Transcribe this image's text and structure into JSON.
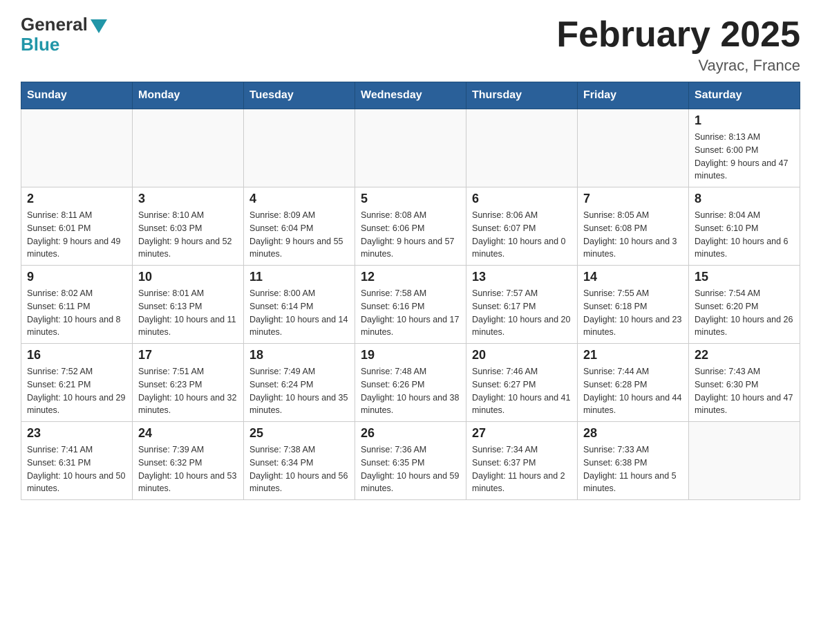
{
  "header": {
    "logo_general": "General",
    "logo_blue": "Blue",
    "month_title": "February 2025",
    "location": "Vayrac, France"
  },
  "days_of_week": [
    "Sunday",
    "Monday",
    "Tuesday",
    "Wednesday",
    "Thursday",
    "Friday",
    "Saturday"
  ],
  "weeks": [
    [
      {
        "day": "",
        "info": ""
      },
      {
        "day": "",
        "info": ""
      },
      {
        "day": "",
        "info": ""
      },
      {
        "day": "",
        "info": ""
      },
      {
        "day": "",
        "info": ""
      },
      {
        "day": "",
        "info": ""
      },
      {
        "day": "1",
        "info": "Sunrise: 8:13 AM\nSunset: 6:00 PM\nDaylight: 9 hours and 47 minutes."
      }
    ],
    [
      {
        "day": "2",
        "info": "Sunrise: 8:11 AM\nSunset: 6:01 PM\nDaylight: 9 hours and 49 minutes."
      },
      {
        "day": "3",
        "info": "Sunrise: 8:10 AM\nSunset: 6:03 PM\nDaylight: 9 hours and 52 minutes."
      },
      {
        "day": "4",
        "info": "Sunrise: 8:09 AM\nSunset: 6:04 PM\nDaylight: 9 hours and 55 minutes."
      },
      {
        "day": "5",
        "info": "Sunrise: 8:08 AM\nSunset: 6:06 PM\nDaylight: 9 hours and 57 minutes."
      },
      {
        "day": "6",
        "info": "Sunrise: 8:06 AM\nSunset: 6:07 PM\nDaylight: 10 hours and 0 minutes."
      },
      {
        "day": "7",
        "info": "Sunrise: 8:05 AM\nSunset: 6:08 PM\nDaylight: 10 hours and 3 minutes."
      },
      {
        "day": "8",
        "info": "Sunrise: 8:04 AM\nSunset: 6:10 PM\nDaylight: 10 hours and 6 minutes."
      }
    ],
    [
      {
        "day": "9",
        "info": "Sunrise: 8:02 AM\nSunset: 6:11 PM\nDaylight: 10 hours and 8 minutes."
      },
      {
        "day": "10",
        "info": "Sunrise: 8:01 AM\nSunset: 6:13 PM\nDaylight: 10 hours and 11 minutes."
      },
      {
        "day": "11",
        "info": "Sunrise: 8:00 AM\nSunset: 6:14 PM\nDaylight: 10 hours and 14 minutes."
      },
      {
        "day": "12",
        "info": "Sunrise: 7:58 AM\nSunset: 6:16 PM\nDaylight: 10 hours and 17 minutes."
      },
      {
        "day": "13",
        "info": "Sunrise: 7:57 AM\nSunset: 6:17 PM\nDaylight: 10 hours and 20 minutes."
      },
      {
        "day": "14",
        "info": "Sunrise: 7:55 AM\nSunset: 6:18 PM\nDaylight: 10 hours and 23 minutes."
      },
      {
        "day": "15",
        "info": "Sunrise: 7:54 AM\nSunset: 6:20 PM\nDaylight: 10 hours and 26 minutes."
      }
    ],
    [
      {
        "day": "16",
        "info": "Sunrise: 7:52 AM\nSunset: 6:21 PM\nDaylight: 10 hours and 29 minutes."
      },
      {
        "day": "17",
        "info": "Sunrise: 7:51 AM\nSunset: 6:23 PM\nDaylight: 10 hours and 32 minutes."
      },
      {
        "day": "18",
        "info": "Sunrise: 7:49 AM\nSunset: 6:24 PM\nDaylight: 10 hours and 35 minutes."
      },
      {
        "day": "19",
        "info": "Sunrise: 7:48 AM\nSunset: 6:26 PM\nDaylight: 10 hours and 38 minutes."
      },
      {
        "day": "20",
        "info": "Sunrise: 7:46 AM\nSunset: 6:27 PM\nDaylight: 10 hours and 41 minutes."
      },
      {
        "day": "21",
        "info": "Sunrise: 7:44 AM\nSunset: 6:28 PM\nDaylight: 10 hours and 44 minutes."
      },
      {
        "day": "22",
        "info": "Sunrise: 7:43 AM\nSunset: 6:30 PM\nDaylight: 10 hours and 47 minutes."
      }
    ],
    [
      {
        "day": "23",
        "info": "Sunrise: 7:41 AM\nSunset: 6:31 PM\nDaylight: 10 hours and 50 minutes."
      },
      {
        "day": "24",
        "info": "Sunrise: 7:39 AM\nSunset: 6:32 PM\nDaylight: 10 hours and 53 minutes."
      },
      {
        "day": "25",
        "info": "Sunrise: 7:38 AM\nSunset: 6:34 PM\nDaylight: 10 hours and 56 minutes."
      },
      {
        "day": "26",
        "info": "Sunrise: 7:36 AM\nSunset: 6:35 PM\nDaylight: 10 hours and 59 minutes."
      },
      {
        "day": "27",
        "info": "Sunrise: 7:34 AM\nSunset: 6:37 PM\nDaylight: 11 hours and 2 minutes."
      },
      {
        "day": "28",
        "info": "Sunrise: 7:33 AM\nSunset: 6:38 PM\nDaylight: 11 hours and 5 minutes."
      },
      {
        "day": "",
        "info": ""
      }
    ]
  ]
}
